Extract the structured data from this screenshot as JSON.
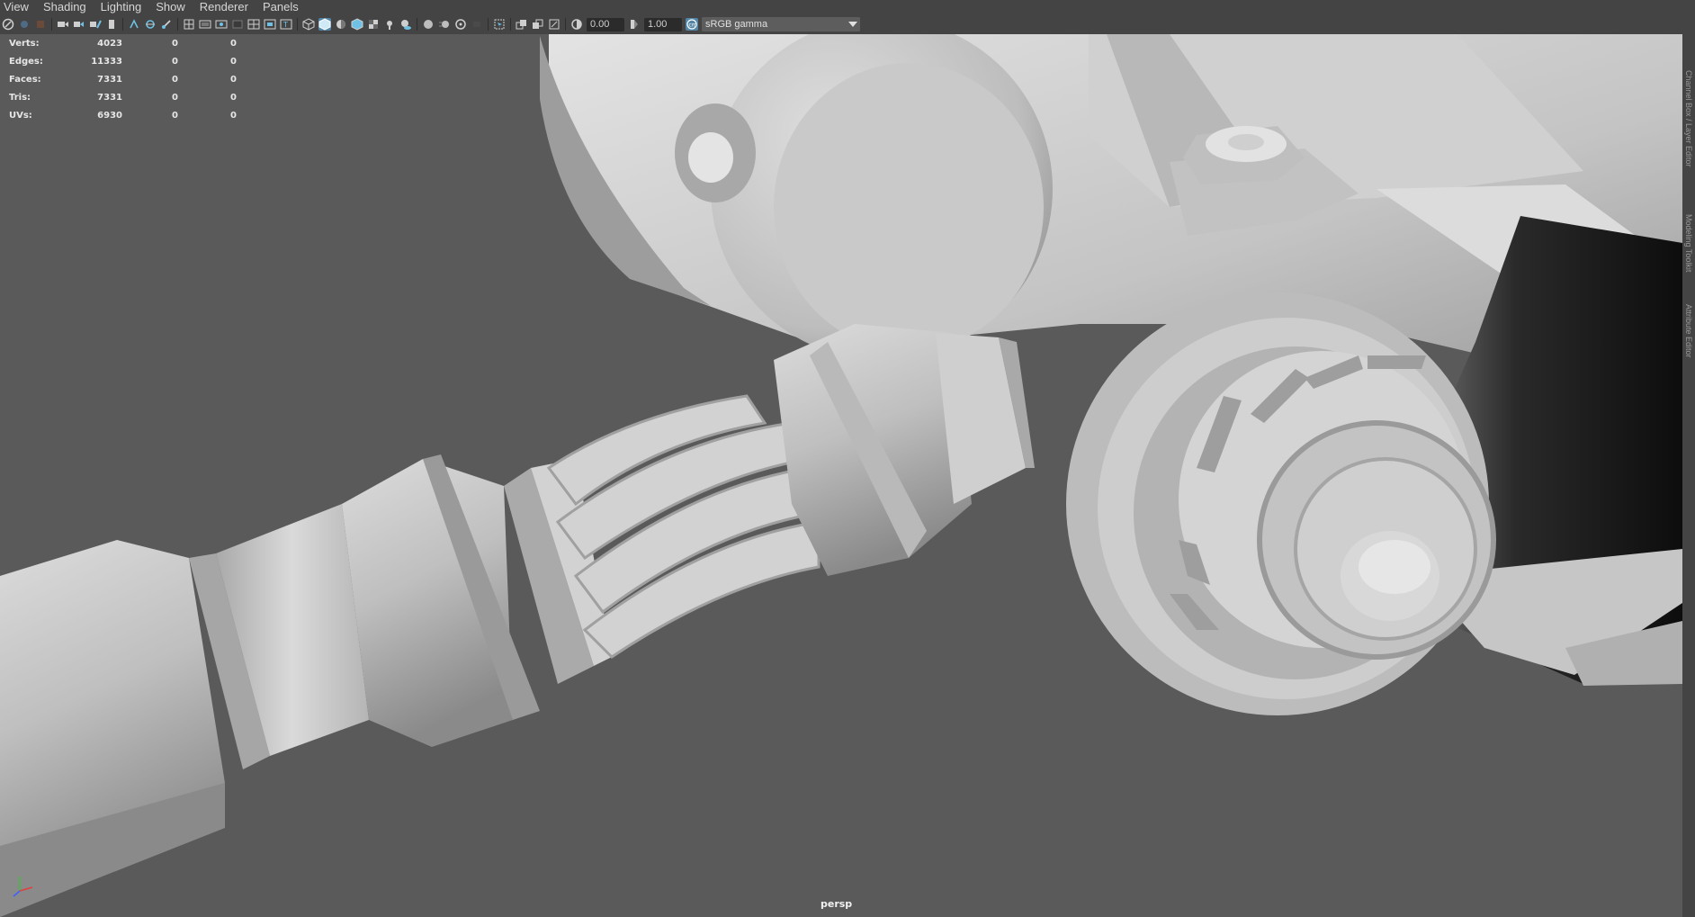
{
  "menubar": {
    "items": [
      "View",
      "Shading",
      "Lighting",
      "Show",
      "Renderer",
      "Panels"
    ]
  },
  "toolbar": {
    "exposure_value": "0.00",
    "gamma_value": "1.00",
    "color_management": {
      "selected": "sRGB gamma"
    },
    "accent_color": "#5285a6"
  },
  "hud": {
    "rows": [
      {
        "label": "Verts:",
        "v1": "4023",
        "v2": "0",
        "v3": "0"
      },
      {
        "label": "Edges:",
        "v1": "11333",
        "v2": "0",
        "v3": "0"
      },
      {
        "label": "Faces:",
        "v1": "7331",
        "v2": "0",
        "v3": "0"
      },
      {
        "label": "Tris:",
        "v1": "7331",
        "v2": "0",
        "v3": "0"
      },
      {
        "label": "UVs:",
        "v1": "6930",
        "v2": "0",
        "v3": "0"
      }
    ]
  },
  "viewport": {
    "camera": "persp",
    "background_color": "#5a5a5a",
    "model_color": "#c8c8c8"
  },
  "right_panel": {
    "tabs": [
      "Channel Box / Layer Editor",
      "Modeling Toolkit",
      "Attribute Editor"
    ]
  }
}
